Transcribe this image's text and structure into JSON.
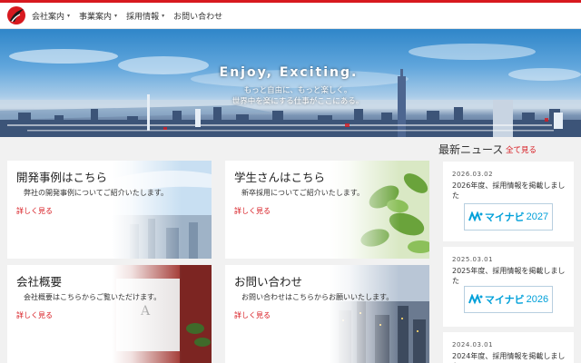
{
  "header": {
    "nav": [
      {
        "label": "会社案内",
        "has_dropdown": true
      },
      {
        "label": "事業案内",
        "has_dropdown": true
      },
      {
        "label": "採用情報",
        "has_dropdown": true
      },
      {
        "label": "お問い合わせ",
        "has_dropdown": false
      }
    ],
    "caret": "▾"
  },
  "hero": {
    "title": "Enjoy, Exciting.",
    "line1": "もっと自由に、もっと楽しく。",
    "line2": "世界中を楽にする仕事がここにある。"
  },
  "cards": [
    {
      "title": "開発事例はこちら",
      "desc": "弊社の開発事例についてご紹介いたします。",
      "link": "詳しく見る"
    },
    {
      "title": "学生さんはこちら",
      "desc": "新卒採用についてご紹介いたします。",
      "link": "詳しく見る"
    },
    {
      "title": "会社概要",
      "desc": "会社概要はこちらからご覧いただけます。",
      "link": "詳しく見る"
    },
    {
      "title": "お問い合わせ",
      "desc": "お問い合わせはこちらからお願いいたします。",
      "link": "詳しく見る"
    }
  ],
  "news": {
    "heading": "最新ニュース",
    "see_all": "全て見る",
    "items": [
      {
        "date": "2026.03.02",
        "text": "2026年度、採用情報を掲載しました",
        "banner_word": "マイナビ",
        "banner_year": "2027"
      },
      {
        "date": "2025.03.01",
        "text": "2025年度、採用情報を掲載しました",
        "banner_word": "マイナビ",
        "banner_year": "2026"
      },
      {
        "date": "2024.03.01",
        "text": "2024年度、採用情報を掲載しました"
      }
    ]
  },
  "colors": {
    "accent": "#d7191f",
    "mynavi_blue": "#00A0D9"
  }
}
